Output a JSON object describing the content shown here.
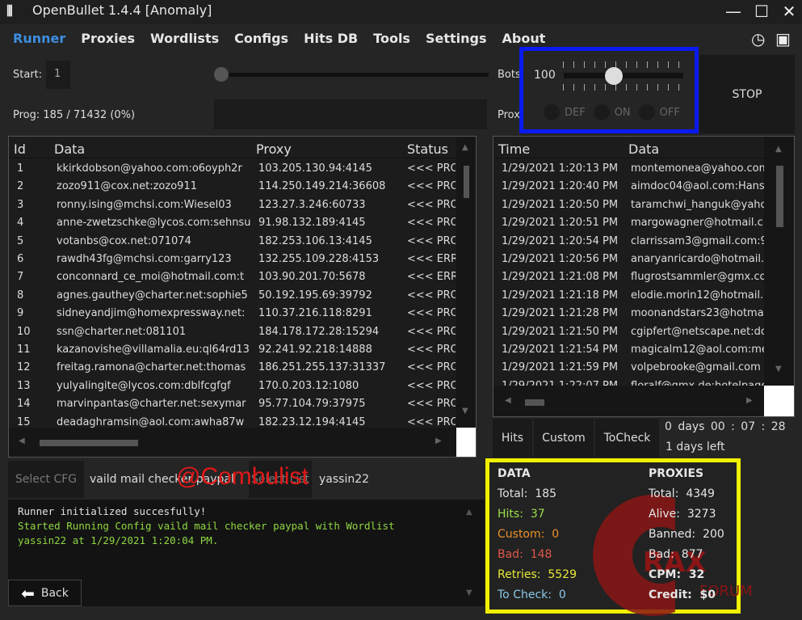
{
  "window": {
    "title": "OpenBullet 1.4.4 [Anomaly]",
    "minimize": "—",
    "maximize": "☐",
    "close": "✕"
  },
  "menu": [
    "Runner",
    "Proxies",
    "Wordlists",
    "Configs",
    "Hits DB",
    "Tools",
    "Settings",
    "About"
  ],
  "runner": {
    "start_label": "Start:",
    "start_value": "1",
    "prog_label": "Prog:",
    "prog_value": "185 / 71432 (0%)",
    "bots_label": "Bots",
    "bots_value": "100",
    "bots_slider_fraction": 0.42,
    "proxies_label": "Prox",
    "proxy_options": [
      "DEF",
      "ON",
      "OFF"
    ],
    "stop_label": "STOP"
  },
  "data_table": {
    "headers": [
      "Id",
      "Data",
      "Proxy",
      "Status"
    ],
    "rows": [
      [
        "1",
        "kkirkdobson@yahoo.com:o6oyph2r",
        "103.205.130.94:4145",
        "<<< PRO"
      ],
      [
        "2",
        "zozo911@cox.net:zozo911",
        "114.250.149.214:36608",
        "<<< PRO"
      ],
      [
        "3",
        "ronny.ising@mchsi.com:Wiesel03",
        "123.27.3.246:60733",
        "<<< PRO"
      ],
      [
        "4",
        "anne-zwetzschke@lycos.com:sehnsu",
        "91.98.132.189:4145",
        "<<< PRO"
      ],
      [
        "5",
        "votanbs@cox.net:071074",
        "182.253.106.13:4145",
        "<<< PRO"
      ],
      [
        "6",
        "rawdh43fg@mchsi.com:garry123",
        "132.255.109.228:4153",
        "<<< ERR"
      ],
      [
        "7",
        "conconnard_ce_moi@hotmail.com:t",
        "103.90.201.70:5678",
        "<<< ERR"
      ],
      [
        "8",
        "agnes.gauthey@charter.net:sophie5",
        "50.192.195.69:39792",
        "<<< PRO"
      ],
      [
        "9",
        "sidneyandjim@homexpressway.net:",
        "110.37.216.118:8291",
        "<<< PRO"
      ],
      [
        "10",
        "ssn@charter.net:081101",
        "184.178.172.28:15294",
        "<<< PRO"
      ],
      [
        "11",
        "kazanovishe@villamalia.eu:ql64rd13",
        "92.241.92.218:14888",
        "<<< PRO"
      ],
      [
        "12",
        "freitag.ramona@charter.net:thomas",
        "186.251.255.137:31337",
        "<<< PRO"
      ],
      [
        "13",
        "yulyalingite@lycos.com:dblfcgfgf",
        "170.0.203.12:1080",
        "<<< PRO"
      ],
      [
        "14",
        "marvinpantas@charter.net:sexymar",
        "95.77.104.79:37975",
        "<<< PRO"
      ],
      [
        "15",
        "deadaghramsin@aol.com:awha87w",
        "182.23.12.194:4145",
        "<<< PRO"
      ]
    ]
  },
  "hits_table": {
    "headers": [
      "Time",
      "Data"
    ],
    "rows": [
      [
        "1/29/2021 1:20:13 PM",
        "montemonea@yahoo.com"
      ],
      [
        "1/29/2021 1:20:40 PM",
        "aimdoc04@aol.com:Hans"
      ],
      [
        "1/29/2021 1:20:50 PM",
        "taramchwi_hanguk@yaho"
      ],
      [
        "1/29/2021 1:20:51 PM",
        "margowagner@hotmail.c"
      ],
      [
        "1/29/2021 1:20:54 PM",
        "clarrissam3@gmail.com:9"
      ],
      [
        "1/29/2021 1:20:56 PM",
        "anaryanricardo@hotmail."
      ],
      [
        "1/29/2021 1:21:08 PM",
        "flugrostsammler@gmx.co"
      ],
      [
        "1/29/2021 1:21:18 PM",
        "elodie.morin12@hotmail."
      ],
      [
        "1/29/2021 1:21:28 PM",
        "moonandstars23@hotma"
      ],
      [
        "1/29/2021 1:21:50 PM",
        "cgipfert@netscape.net:dc"
      ],
      [
        "1/29/2021 1:21:54 PM",
        "magicalm12@aol.com:me"
      ],
      [
        "1/29/2021 1:21:59 PM",
        "volpebrooke@gmail.com"
      ],
      [
        "1/29/2021 1:22:07 PM",
        "floralf@gmx.de:hotelpage"
      ]
    ]
  },
  "hit_tabs": [
    "Hits",
    "Custom",
    "ToCheck"
  ],
  "timer": {
    "elapsed": "0 days 00 : 07 : 28",
    "left": "1 days left"
  },
  "config": {
    "select_cfg": "Select CFG",
    "cfg_name": "vaild mail checker paypal",
    "select_list": "Select List",
    "list_name": "yassin22",
    "watermark": "@Combulist"
  },
  "log": {
    "line1": "Runner initialized succesfully!",
    "line2": "Started Running Config vaild mail checker paypal with Wordlist yassin22 at 1/29/2021 1:20:04 PM."
  },
  "back_label": "Back",
  "stats": {
    "data_title": "DATA",
    "proxies_title": "PROXIES",
    "data": [
      {
        "label": "Total:",
        "value": "185",
        "color": "#e0e0e0"
      },
      {
        "label": "Hits:",
        "value": "37",
        "color": "#9be04a"
      },
      {
        "label": "Custom:",
        "value": "0",
        "color": "#e8902a"
      },
      {
        "label": "Bad:",
        "value": "148",
        "color": "#e0584a"
      },
      {
        "label": "Retries:",
        "value": "5529",
        "color": "#e8e83a"
      },
      {
        "label": "To Check:",
        "value": "0",
        "color": "#8cc8e8"
      }
    ],
    "proxies": [
      {
        "label": "Total:",
        "value": "4349"
      },
      {
        "label": "Alive:",
        "value": "3273"
      },
      {
        "label": "Banned:",
        "value": "200"
      },
      {
        "label": "Bad:",
        "value": "877"
      },
      {
        "label": "CPM:",
        "value": "32"
      },
      {
        "label": "Credit:",
        "value": "$0"
      }
    ]
  },
  "logo_watermark": "CRAX FORUM"
}
